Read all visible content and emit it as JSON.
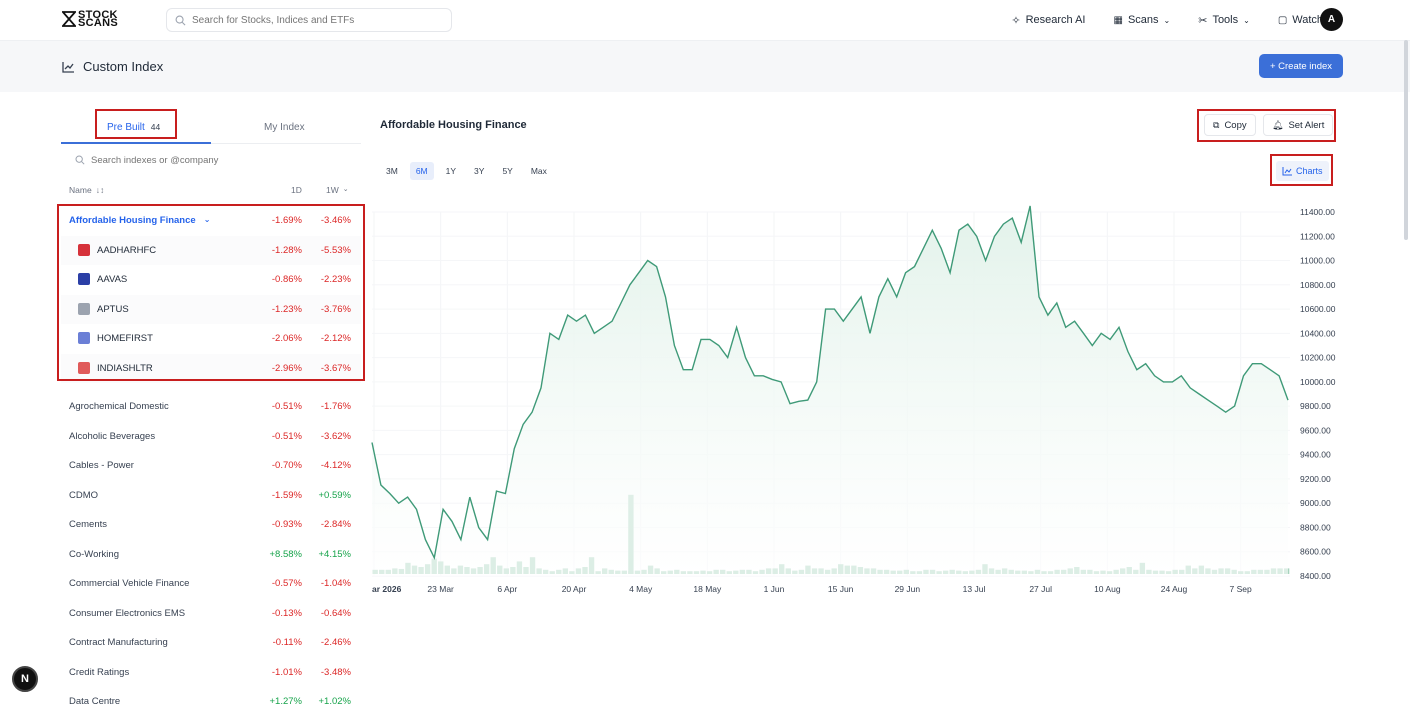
{
  "brand": {
    "logo_line1": "STOCK",
    "logo_line2": "SCANS"
  },
  "search": {
    "placeholder": "Search for Stocks, Indices and ETFs"
  },
  "nav": {
    "research": "Research AI",
    "scans": "Scans",
    "tools": "Tools",
    "watchlists": "Watchlists",
    "avatar": "A"
  },
  "page": {
    "title": "Custom Index",
    "create_label": "+ Create index"
  },
  "tabs": {
    "prebuilt_label": "Pre Built",
    "prebuilt_count": "44",
    "my_label": "My Index"
  },
  "list": {
    "search_placeholder": "Search indexes or @company",
    "col_name": "Name",
    "col_1d": "1D",
    "col_1w": "1W",
    "group": {
      "name": "Affordable Housing Finance",
      "d1": "-1.69%",
      "w1": "-3.46%",
      "items": [
        {
          "name": "AADHARHFC",
          "d1": "-1.28%",
          "w1": "-5.53%",
          "icon": "aadhar-logo",
          "color": "#d6323a"
        },
        {
          "name": "AAVAS",
          "d1": "-0.86%",
          "w1": "-2.23%",
          "icon": "aavas-logo",
          "color": "#2b3fa6"
        },
        {
          "name": "APTUS",
          "d1": "-1.23%",
          "w1": "-3.76%",
          "icon": "aptus-logo",
          "color": "#9ca3af"
        },
        {
          "name": "HOMEFIRST",
          "d1": "-2.06%",
          "w1": "-2.12%",
          "icon": "homefirst-logo",
          "color": "#6b7fd6"
        },
        {
          "name": "INDIASHLTR",
          "d1": "-2.96%",
          "w1": "-3.67%",
          "icon": "indiashltr-logo",
          "color": "#e05a5a"
        }
      ]
    },
    "rows": [
      {
        "name": "Agrochemical Domestic",
        "d1": "-0.51%",
        "w1": "-1.76%"
      },
      {
        "name": "Alcoholic Beverages",
        "d1": "-0.51%",
        "w1": "-3.62%"
      },
      {
        "name": "Cables - Power",
        "d1": "-0.70%",
        "w1": "-4.12%"
      },
      {
        "name": "CDMO",
        "d1": "-1.59%",
        "w1": "+0.59%"
      },
      {
        "name": "Cements",
        "d1": "-0.93%",
        "w1": "-2.84%"
      },
      {
        "name": "Co-Working",
        "d1": "+8.58%",
        "w1": "+4.15%"
      },
      {
        "name": "Commercial Vehicle Finance",
        "d1": "-0.57%",
        "w1": "-1.04%"
      },
      {
        "name": "Consumer Electronics EMS",
        "d1": "-0.13%",
        "w1": "-0.64%"
      },
      {
        "name": "Contract Manufacturing",
        "d1": "-0.11%",
        "w1": "-2.46%"
      },
      {
        "name": "Credit Ratings",
        "d1": "-1.01%",
        "w1": "-3.48%"
      },
      {
        "name": "Data Centre",
        "d1": "+1.27%",
        "w1": "+1.02%"
      }
    ]
  },
  "detail": {
    "title": "Affordable Housing Finance",
    "copy_label": "Copy",
    "alert_label": "Set Alert",
    "charts_label": "Charts",
    "ranges": [
      "3M",
      "6M",
      "1Y",
      "3Y",
      "5Y",
      "Max"
    ],
    "active_range": "6M"
  },
  "chart_data": {
    "type": "area",
    "y_ticks": [
      "11400.00",
      "11200.00",
      "11000.00",
      "10800.00",
      "10600.00",
      "10400.00",
      "10200.00",
      "10000.00",
      "9800.00",
      "9600.00",
      "9400.00",
      "9200.00",
      "9000.00",
      "8800.00",
      "8600.00",
      "8400.00"
    ],
    "x_ticks": [
      "ar 2026",
      "23 Mar",
      "6 Apr",
      "20 Apr",
      "4 May",
      "18 May",
      "1 Jun",
      "15 Jun",
      "29 Jun",
      "13 Jul",
      "27 Jul",
      "10 Aug",
      "24 Aug",
      "7 Sep"
    ],
    "ylim": [
      8400,
      11400
    ],
    "line_color": "#3f9a78",
    "fill_color": "#e2f2ea",
    "volume_color": "#a7d3bd",
    "price": [
      9500,
      9150,
      9080,
      9000,
      9050,
      8950,
      8700,
      8550,
      8950,
      8850,
      8700,
      9050,
      8800,
      8700,
      9100,
      9080,
      9450,
      9650,
      9750,
      9950,
      10400,
      10350,
      10550,
      10500,
      10550,
      10400,
      10450,
      10500,
      10650,
      10800,
      10900,
      11000,
      10950,
      10700,
      10300,
      10100,
      10100,
      10350,
      10350,
      10300,
      10200,
      10450,
      10200,
      10050,
      10050,
      10020,
      10000,
      9820,
      9840,
      9850,
      10000,
      10600,
      10600,
      10500,
      10600,
      10700,
      10400,
      10700,
      10850,
      10700,
      10900,
      10950,
      11100,
      11250,
      11100,
      10900,
      11250,
      11300,
      11200,
      11000,
      11200,
      11300,
      11350,
      11150,
      11450,
      10700,
      10550,
      10650,
      10450,
      10500,
      10400,
      10300,
      10400,
      10350,
      10450,
      10250,
      10100,
      10150,
      10050,
      10000,
      10000,
      10050,
      9950,
      9900,
      9850,
      9800,
      9750,
      9800,
      10050,
      10150,
      10150,
      10100,
      10050,
      9850
    ],
    "volume": [
      0.15,
      0.15,
      0.15,
      0.2,
      0.18,
      0.4,
      0.3,
      0.25,
      0.35,
      0.55,
      0.45,
      0.3,
      0.2,
      0.3,
      0.25,
      0.2,
      0.25,
      0.35,
      0.6,
      0.3,
      0.2,
      0.25,
      0.45,
      0.25,
      0.6,
      0.2,
      0.15,
      0.1,
      0.15,
      0.2,
      0.1,
      0.2,
      0.25,
      0.6,
      0.1,
      0.2,
      0.15,
      0.12,
      0.12,
      0.1,
      0.12,
      0.15,
      0.3,
      0.2,
      0.1,
      0.12,
      0.15,
      0.1,
      0.1,
      0.1,
      0.12,
      0.1,
      0.15,
      0.15,
      0.1,
      0.12,
      0.15,
      0.15,
      0.1,
      0.15,
      0.2,
      0.2,
      0.35,
      0.2,
      0.12,
      0.15,
      0.3,
      0.2,
      0.2,
      0.15,
      0.2,
      0.35,
      0.3,
      0.3,
      0.25,
      0.2,
      0.2,
      0.15,
      0.15,
      0.12,
      0.12,
      0.15,
      0.1,
      0.1,
      0.15,
      0.15,
      0.1,
      0.12,
      0.15,
      0.12,
      0.1,
      0.12,
      0.15,
      0.35,
      0.2,
      0.15,
      0.2,
      0.15,
      0.12,
      0.12,
      0.1,
      0.15,
      0.1,
      0.1,
      0.15,
      0.15,
      0.2,
      0.25,
      0.15,
      0.15,
      0.1,
      0.12,
      0.1,
      0.15,
      0.2,
      0.25,
      0.15,
      0.4,
      0.15,
      0.12,
      0.12,
      0.1,
      0.15,
      0.15,
      0.3,
      0.2,
      0.3,
      0.2,
      0.15,
      0.2,
      0.2,
      0.15,
      0.1,
      0.1,
      0.15,
      0.15,
      0.15,
      0.2,
      0.2,
      0.2
    ],
    "volume_spike": {
      "label": "4 May",
      "value": 1.8
    }
  }
}
